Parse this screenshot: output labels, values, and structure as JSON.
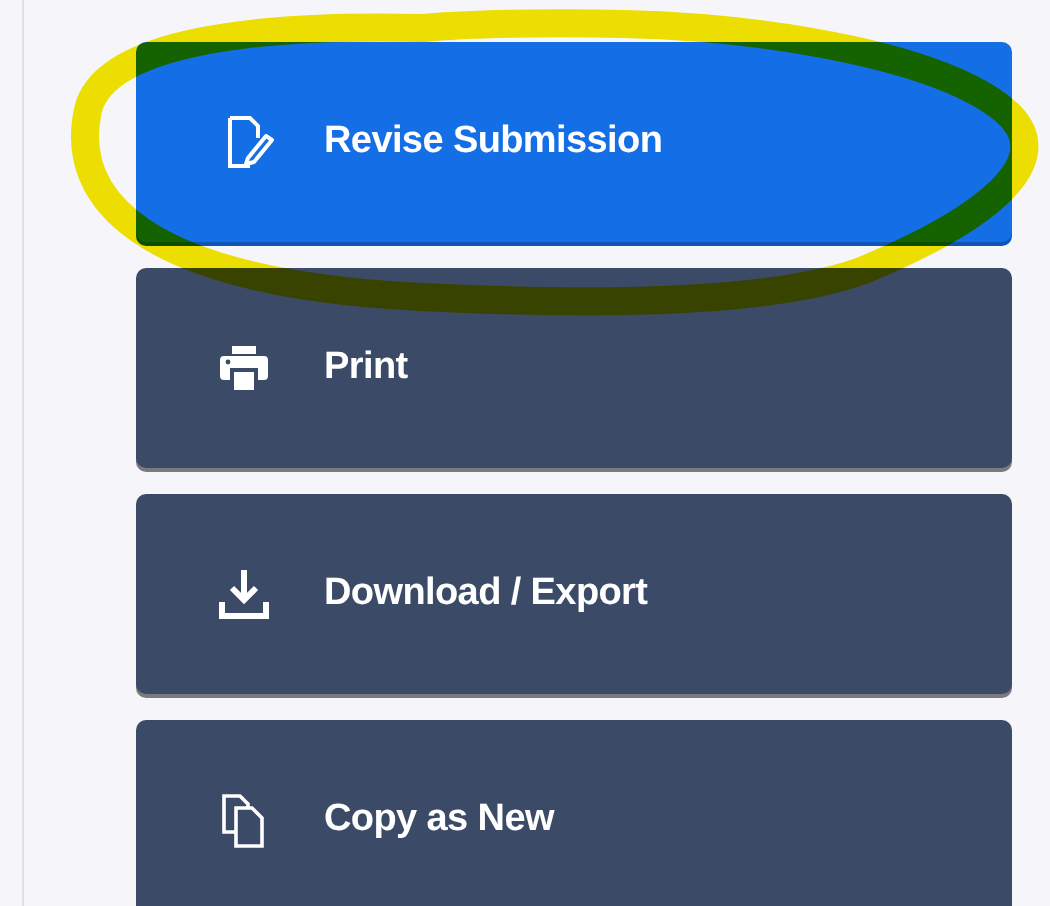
{
  "actions": [
    {
      "label": "Revise Submission",
      "kind": "revise",
      "selected": true
    },
    {
      "label": "Print",
      "kind": "print",
      "selected": false
    },
    {
      "label": "Download / Export",
      "kind": "download",
      "selected": false
    },
    {
      "label": "Copy as New",
      "kind": "copy",
      "selected": false
    }
  ],
  "annotation": {
    "kind": "highlight",
    "color": "#f5e600"
  }
}
